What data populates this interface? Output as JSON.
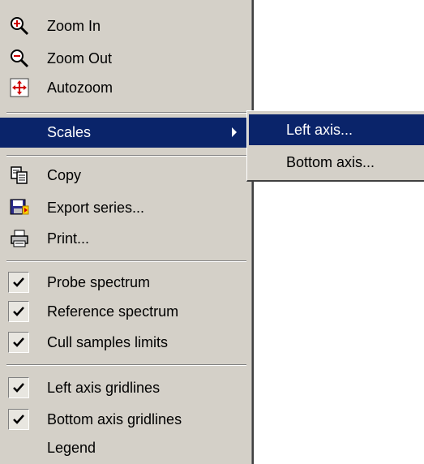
{
  "menu": {
    "zoom_in": "Zoom In",
    "zoom_out": "Zoom Out",
    "autozoom": "Autozoom",
    "scales": "Scales",
    "copy": "Copy",
    "export_series": "Export series...",
    "print": "Print...",
    "probe_spectrum": "Probe spectrum",
    "reference_spectrum": "Reference spectrum",
    "cull_samples_limits": "Cull samples limits",
    "left_axis_gridlines": "Left axis gridlines",
    "bottom_axis_gridlines": "Bottom axis gridlines",
    "legend": "Legend"
  },
  "submenu": {
    "left_axis": "Left axis...",
    "bottom_axis": "Bottom axis..."
  },
  "checked": {
    "probe_spectrum": true,
    "reference_spectrum": true,
    "cull_samples_limits": true,
    "left_axis_gridlines": true,
    "bottom_axis_gridlines": true,
    "legend": false
  },
  "colors": {
    "menu_bg": "#d4d0c8",
    "highlight": "#0a246a",
    "highlight_text": "#ffffff"
  }
}
